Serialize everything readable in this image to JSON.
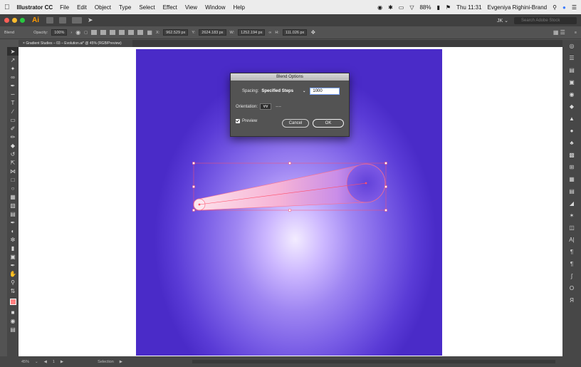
{
  "menubar": {
    "app_name": "Illustrator CC",
    "items": [
      "File",
      "Edit",
      "Object",
      "Type",
      "Select",
      "Effect",
      "View",
      "Window",
      "Help"
    ],
    "battery": "88%",
    "clock": "Thu 11:31",
    "user": "Evgeniya Righini-Brand"
  },
  "appbar": {
    "logo": "Ai",
    "workspace": "JK ⌄",
    "search_placeholder": "Search Adobe Stock"
  },
  "controlbar": {
    "mode_label": "Blend",
    "opacity_label": "Opacity:",
    "opacity_value": "100%",
    "x_label": "X:",
    "x_value": "962.529 px",
    "y_label": "Y:",
    "y_value": "2624.183 px",
    "w_label": "W:",
    "w_value": "1252.194 px",
    "h_label": "H:",
    "h_value": "111.026 px"
  },
  "document": {
    "tab_title": "Gradient Studies – 03 – Evolution.ai* @ 45% (RGB/Preview)"
  },
  "dialog": {
    "title": "Blend Options",
    "spacing_label": "Spacing:",
    "spacing_value": "Specified Steps",
    "steps_value": "1000",
    "orientation_label": "Orientation:",
    "preview_label": "Preview",
    "cancel_label": "Cancel",
    "ok_label": "OK"
  },
  "statusbar": {
    "zoom": "45%",
    "artboard": "1",
    "tool": "Selection"
  },
  "colors": {
    "accent": "#ff9a00",
    "artboard_gradient_center": "#f3ecff",
    "artboard_gradient_edge": "#4a2bc8",
    "selection": "#ff4f6a"
  }
}
